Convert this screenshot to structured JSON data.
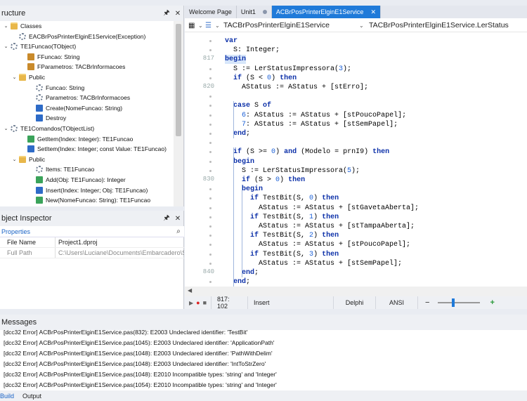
{
  "structure": {
    "title": "ructure",
    "nodes": [
      {
        "text": "Classes",
        "icon": "folder-icon",
        "type": "folder",
        "indent": 0,
        "tog": "minus"
      },
      {
        "text": "EACBrPosPrinterElginE1Service(Exception)",
        "icon": "class-gear-icon",
        "type": "gear",
        "indent": 1,
        "tog": ""
      },
      {
        "text": "TE1Funcao(TObject)",
        "icon": "class-gear-icon",
        "type": "gear",
        "indent": 0,
        "tog": "minus"
      },
      {
        "text": "FFuncao: String",
        "icon": "field-icon",
        "type": "prop",
        "indent": 2,
        "tog": ""
      },
      {
        "text": "FParametros: TACBrInformacoes",
        "icon": "field-icon",
        "type": "prop",
        "indent": 2,
        "tog": ""
      },
      {
        "text": "Public",
        "icon": "folder-icon",
        "type": "folder",
        "indent": 1,
        "tog": "minus"
      },
      {
        "text": "Funcao: String",
        "icon": "property-icon",
        "type": "gear",
        "indent": 3,
        "tog": ""
      },
      {
        "text": "Parametros: TACBrInformacoes",
        "icon": "property-icon",
        "type": "gear",
        "indent": 3,
        "tog": ""
      },
      {
        "text": "Create(NomeFuncao: String)",
        "icon": "method-icon",
        "type": "meth",
        "indent": 3,
        "tog": ""
      },
      {
        "text": "Destroy",
        "icon": "method-icon",
        "type": "meth",
        "indent": 3,
        "tog": ""
      },
      {
        "text": "TE1Comandos(TObjectList)",
        "icon": "class-gear-icon",
        "type": "gear",
        "indent": 0,
        "tog": "minus"
      },
      {
        "text": "GetItem(Index: Integer): TE1Funcao",
        "icon": "function-icon",
        "type": "fn",
        "indent": 2,
        "tog": ""
      },
      {
        "text": "SetItem(Index: Integer; const Value: TE1Funcao)",
        "icon": "method-icon",
        "type": "meth",
        "indent": 2,
        "tog": ""
      },
      {
        "text": "Public",
        "icon": "folder-icon",
        "type": "folder",
        "indent": 1,
        "tog": "minus"
      },
      {
        "text": "Items: TE1Funcao",
        "icon": "property-icon",
        "type": "gear",
        "indent": 3,
        "tog": ""
      },
      {
        "text": "Add(Obj: TE1Funcao): Integer",
        "icon": "function-icon",
        "type": "fn",
        "indent": 3,
        "tog": ""
      },
      {
        "text": "Insert(Index: Integer; Obj: TE1Funcao)",
        "icon": "method-icon",
        "type": "meth",
        "indent": 3,
        "tog": ""
      },
      {
        "text": "New(NomeFuncao: String): TE1Funcao",
        "icon": "function-icon",
        "type": "fn",
        "indent": 3,
        "tog": ""
      }
    ]
  },
  "inspector": {
    "title": "bject Inspector",
    "tab": "Properties",
    "rows": [
      {
        "key": "File Name",
        "value": "Project1.dproj",
        "muted": false
      },
      {
        "key": "Full Path",
        "value": "C:\\Users\\Luciane\\Documents\\Embarcadero\\S",
        "muted": true
      }
    ]
  },
  "editor": {
    "tabs": [
      {
        "label": "Welcome Page",
        "active": false
      },
      {
        "label": "Unit1",
        "active": false
      },
      {
        "label": "ACBrPosPrinterElginE1Service",
        "active": true
      }
    ],
    "nav_left": "TACBrPosPrinterElginE1Service",
    "nav_right": "TACBrPosPrinterElginE1Service.LerStatus",
    "line_numbers": [
      {
        "n": "817",
        "row": 2
      },
      {
        "n": "820",
        "row": 5
      },
      {
        "n": "830",
        "row": 15
      },
      {
        "n": "840",
        "row": 25
      }
    ],
    "code_lines": [
      [
        {
          "t": "var",
          "c": "kw",
          "i": 0
        }
      ],
      [
        {
          "t": "  S: Integer;",
          "c": "",
          "i": 0
        }
      ],
      [
        {
          "t": "begin",
          "c": "kw",
          "i": 0
        }
      ],
      [
        {
          "t": "  S := LerStatusImpressora(",
          "c": "",
          "i": 0
        },
        {
          "t": "3",
          "c": "num"
        },
        {
          "t": ");",
          "c": ""
        }
      ],
      [
        {
          "t": "  ",
          "c": ""
        },
        {
          "t": "if",
          "c": "kw"
        },
        {
          "t": " (S < ",
          "c": ""
        },
        {
          "t": "0",
          "c": "num"
        },
        {
          "t": ") ",
          "c": ""
        },
        {
          "t": "then",
          "c": "kw"
        }
      ],
      [
        {
          "t": "    AStatus := AStatus + [stErro];",
          "c": ""
        }
      ],
      [
        {
          "t": "",
          "c": ""
        }
      ],
      [
        {
          "t": "  ",
          "c": ""
        },
        {
          "t": "case",
          "c": "kw"
        },
        {
          "t": " S ",
          "c": ""
        },
        {
          "t": "of",
          "c": "kw"
        }
      ],
      [
        {
          "t": "    ",
          "c": ""
        },
        {
          "t": "6",
          "c": "num"
        },
        {
          "t": ": AStatus := AStatus + [stPoucoPapel];",
          "c": ""
        }
      ],
      [
        {
          "t": "    ",
          "c": ""
        },
        {
          "t": "7",
          "c": "num"
        },
        {
          "t": ": AStatus := AStatus + [stSemPapel];",
          "c": ""
        }
      ],
      [
        {
          "t": "  ",
          "c": ""
        },
        {
          "t": "end",
          "c": "kw"
        },
        {
          "t": ";",
          "c": ""
        }
      ],
      [
        {
          "t": "",
          "c": ""
        }
      ],
      [
        {
          "t": "  ",
          "c": ""
        },
        {
          "t": "if",
          "c": "kw"
        },
        {
          "t": " (S >= ",
          "c": ""
        },
        {
          "t": "0",
          "c": "num"
        },
        {
          "t": ") ",
          "c": ""
        },
        {
          "t": "and",
          "c": "kw"
        },
        {
          "t": " (Modelo = prnI9) ",
          "c": ""
        },
        {
          "t": "then",
          "c": "kw"
        }
      ],
      [
        {
          "t": "  ",
          "c": ""
        },
        {
          "t": "begin",
          "c": "kw"
        }
      ],
      [
        {
          "t": "    S := LerStatusImpressora(",
          "c": ""
        },
        {
          "t": "5",
          "c": "num"
        },
        {
          "t": ");",
          "c": ""
        }
      ],
      [
        {
          "t": "    ",
          "c": ""
        },
        {
          "t": "if",
          "c": "kw"
        },
        {
          "t": " (S > ",
          "c": ""
        },
        {
          "t": "0",
          "c": "num"
        },
        {
          "t": ") ",
          "c": ""
        },
        {
          "t": "then",
          "c": "kw"
        }
      ],
      [
        {
          "t": "    ",
          "c": ""
        },
        {
          "t": "begin",
          "c": "kw"
        }
      ],
      [
        {
          "t": "      ",
          "c": ""
        },
        {
          "t": "if",
          "c": "kw"
        },
        {
          "t": " TestBit(S, ",
          "c": ""
        },
        {
          "t": "0",
          "c": "num"
        },
        {
          "t": ") ",
          "c": ""
        },
        {
          "t": "then",
          "c": "kw"
        }
      ],
      [
        {
          "t": "        AStatus := AStatus + [stGavetaAberta];",
          "c": ""
        }
      ],
      [
        {
          "t": "      ",
          "c": ""
        },
        {
          "t": "if",
          "c": "kw"
        },
        {
          "t": " TestBit(S, ",
          "c": ""
        },
        {
          "t": "1",
          "c": "num"
        },
        {
          "t": ") ",
          "c": ""
        },
        {
          "t": "then",
          "c": "kw"
        }
      ],
      [
        {
          "t": "        AStatus := AStatus + [stTampaAberta];",
          "c": ""
        }
      ],
      [
        {
          "t": "      ",
          "c": ""
        },
        {
          "t": "if",
          "c": "kw"
        },
        {
          "t": " TestBit(S, ",
          "c": ""
        },
        {
          "t": "2",
          "c": "num"
        },
        {
          "t": ") ",
          "c": ""
        },
        {
          "t": "then",
          "c": "kw"
        }
      ],
      [
        {
          "t": "        AStatus := AStatus + [stPoucoPapel];",
          "c": ""
        }
      ],
      [
        {
          "t": "      ",
          "c": ""
        },
        {
          "t": "if",
          "c": "kw"
        },
        {
          "t": " TestBit(S, ",
          "c": ""
        },
        {
          "t": "3",
          "c": "num"
        },
        {
          "t": ") ",
          "c": ""
        },
        {
          "t": "then",
          "c": "kw"
        }
      ],
      [
        {
          "t": "        AStatus := AStatus + [stSemPapel];",
          "c": ""
        }
      ],
      [
        {
          "t": "    ",
          "c": ""
        },
        {
          "t": "end",
          "c": "kw"
        },
        {
          "t": ";",
          "c": ""
        }
      ],
      [
        {
          "t": "  ",
          "c": ""
        },
        {
          "t": "end",
          "c": "kw"
        },
        {
          "t": ";",
          "c": ""
        }
      ]
    ],
    "status": {
      "position": "817: 102",
      "mode": "Insert",
      "language": "Delphi",
      "encoding": "ANSI"
    }
  },
  "messages": {
    "title": "Messages",
    "items": [
      "[dcc32 Error] ACBrPosPrinterElginE1Service.pas(832): E2003 Undeclared identifier: 'TestBit'",
      "[dcc32 Error] ACBrPosPrinterElginE1Service.pas(1045): E2003 Undeclared identifier: 'ApplicationPath'",
      "[dcc32 Error] ACBrPosPrinterElginE1Service.pas(1048): E2003 Undeclared identifier: 'PathWithDelim'",
      "[dcc32 Error] ACBrPosPrinterElginE1Service.pas(1048): E2003 Undeclared identifier: 'IntToStrZero'",
      "[dcc32 Error] ACBrPosPrinterElginE1Service.pas(1048): E2010 Incompatible types: 'string' and 'Integer'",
      "[dcc32 Error] ACBrPosPrinterElginE1Service.pas(1054): E2010 Incompatible types: 'string' and 'Integer'"
    ],
    "bottom_tabs": [
      "Build",
      "Output"
    ]
  },
  "colors": {
    "accent": "#1f7ad9",
    "keyword": "#0b2fa8",
    "number": "#1a5fd6"
  }
}
